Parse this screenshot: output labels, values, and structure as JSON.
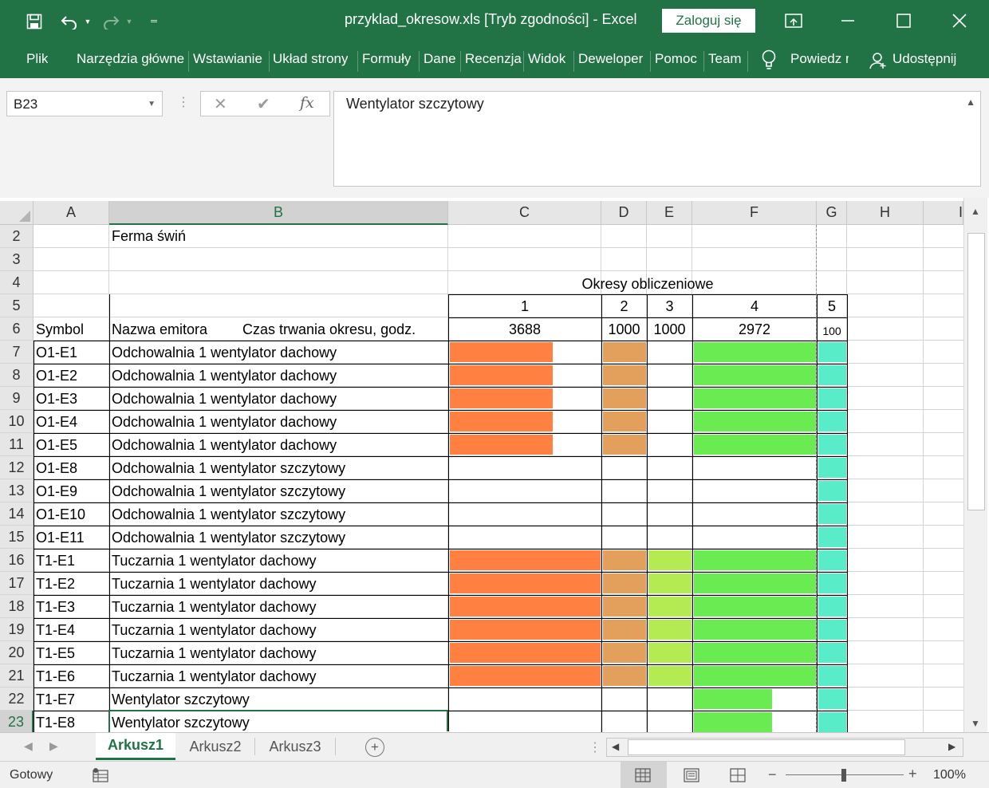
{
  "window": {
    "title": "przyklad_okresow.xls  [Tryb zgodności]  -  Excel",
    "login_label": "Zaloguj się",
    "accent": "#217346"
  },
  "ribbon": {
    "tabs": [
      "Plik",
      "Narzędzia główne",
      "Wstawianie",
      "Układ strony",
      "Formuły",
      "Dane",
      "Recenzja",
      "Widok",
      "Deweloper",
      "Pomoc",
      "Team"
    ],
    "tell_me": "Powiedz m",
    "share": "Udostępnij"
  },
  "formula_bar": {
    "name_box": "B23",
    "content": "Wentylator szczytowy"
  },
  "columns": [
    "A",
    "B",
    "C",
    "D",
    "E",
    "F",
    "G",
    "H",
    "I"
  ],
  "rows": {
    "r2": {
      "num": "2",
      "b": "Ferma świń"
    },
    "r3": {
      "num": "3"
    },
    "r4": {
      "num": "4",
      "header": "Okresy obliczeniowe"
    },
    "r5": {
      "num": "5",
      "c": "1",
      "d": "2",
      "e": "3",
      "f": "4",
      "g": "5"
    },
    "r6": {
      "num": "6",
      "a": "Symbol",
      "b": "Nazwa emitora",
      "b2": "Czas trwania okresu, godz.",
      "c": "3688",
      "d": "1000",
      "e": "1000",
      "f": "2972",
      "g": "100"
    }
  },
  "emitters": [
    {
      "num": "7",
      "symbol": "O1-E1",
      "name": "Odchowalnia 1 wentylator dachowy",
      "p1": 0.68,
      "p2": 1,
      "p3": 0,
      "p4": 1,
      "p5": 1
    },
    {
      "num": "8",
      "symbol": "O1-E2",
      "name": "Odchowalnia 1 wentylator dachowy",
      "p1": 0.68,
      "p2": 1,
      "p3": 0,
      "p4": 1,
      "p5": 1
    },
    {
      "num": "9",
      "symbol": "O1-E3",
      "name": "Odchowalnia 1 wentylator dachowy",
      "p1": 0.68,
      "p2": 1,
      "p3": 0,
      "p4": 1,
      "p5": 1
    },
    {
      "num": "10",
      "symbol": "O1-E4",
      "name": "Odchowalnia 1 wentylator dachowy",
      "p1": 0.68,
      "p2": 1,
      "p3": 0,
      "p4": 1,
      "p5": 1
    },
    {
      "num": "11",
      "symbol": "O1-E5",
      "name": " Odchowalnia 1 wentylator dachowy",
      "p1": 0.68,
      "p2": 1,
      "p3": 0,
      "p4": 1,
      "p5": 1
    },
    {
      "num": "12",
      "symbol": "O1-E8",
      "name": "Odchowalnia 1 wentylator szczytowy",
      "p1": 0,
      "p2": 0,
      "p3": 0,
      "p4": 0,
      "p5": 1
    },
    {
      "num": "13",
      "symbol": "O1-E9",
      "name": "Odchowalnia 1 wentylator szczytowy",
      "p1": 0,
      "p2": 0,
      "p3": 0,
      "p4": 0,
      "p5": 1
    },
    {
      "num": "14",
      "symbol": "O1-E10",
      "name": "Odchowalnia 1 wentylator szczytowy",
      "p1": 0,
      "p2": 0,
      "p3": 0,
      "p4": 0,
      "p5": 1
    },
    {
      "num": "15",
      "symbol": "O1-E11",
      "name": "Odchowalnia 1 wentylator szczytowy",
      "p1": 0,
      "p2": 0,
      "p3": 0,
      "p4": 0,
      "p5": 1
    },
    {
      "num": "16",
      "symbol": "T1-E1",
      "name": "Tuczarnia 1  wentylator dachowy",
      "p1": 1,
      "p2": 1,
      "p3": 1,
      "p4": 1,
      "p5": 1
    },
    {
      "num": "17",
      "symbol": "T1-E2",
      "name": "Tuczarnia 1  wentylator dachowy",
      "p1": 1,
      "p2": 1,
      "p3": 1,
      "p4": 1,
      "p5": 1
    },
    {
      "num": "18",
      "symbol": "T1-E3",
      "name": "Tuczarnia 1  wentylator dachowy",
      "p1": 1,
      "p2": 1,
      "p3": 1,
      "p4": 1,
      "p5": 1
    },
    {
      "num": "19",
      "symbol": "T1-E4",
      "name": "Tuczarnia 1  wentylator dachowy",
      "p1": 1,
      "p2": 1,
      "p3": 1,
      "p4": 1,
      "p5": 1
    },
    {
      "num": "20",
      "symbol": "T1-E5",
      "name": "Tuczarnia 1  wentylator dachowy",
      "p1": 1,
      "p2": 1,
      "p3": 1,
      "p4": 1,
      "p5": 1
    },
    {
      "num": "21",
      "symbol": "T1-E6",
      "name": "Tuczarnia 1  wentylator dachowy",
      "p1": 1,
      "p2": 1,
      "p3": 1,
      "p4": 1,
      "p5": 1
    },
    {
      "num": "22",
      "symbol": "T1-E7",
      "name": "Wentylator szczytowy",
      "p1": 0,
      "p2": 0,
      "p3": 0,
      "p4": 0.64,
      "p5": 1
    },
    {
      "num": "23",
      "symbol": "T1-E8",
      "name": "Wentylator szczytowy",
      "p1": 0,
      "p2": 0,
      "p3": 0,
      "p4": 0.64,
      "p5": 1
    }
  ],
  "period_colors": {
    "p1": "#ff8040",
    "p2": "#e3a05c",
    "p3": "#b4ea52",
    "p4": "#6aeb52",
    "p5": "#58edc8"
  },
  "sheets": [
    "Arkusz1",
    "Arkusz2",
    "Arkusz3"
  ],
  "active_sheet": "Arkusz1",
  "status": {
    "ready": "Gotowy",
    "zoom": "100%"
  }
}
